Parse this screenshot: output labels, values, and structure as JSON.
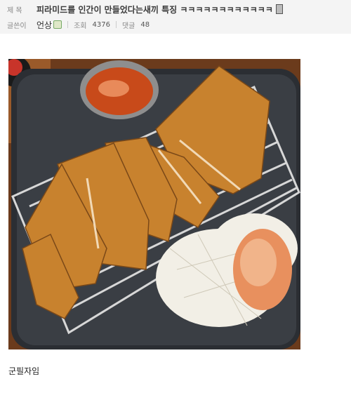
{
  "post": {
    "title_label": "제 목",
    "title": "피라미드를 인간이 만들었다는새끼 특징 ㅋㅋㅋㅋㅋㅋㅋㅋㅋㅋㅋㅋ",
    "author_label": "글쓴이",
    "author": "언상",
    "views_label": "조회",
    "views": "4376",
    "comments_label": "댓글",
    "comments": "48"
  },
  "body": {
    "caption": "군필자임",
    "photo_icon": "fried-cutlet-photo"
  }
}
